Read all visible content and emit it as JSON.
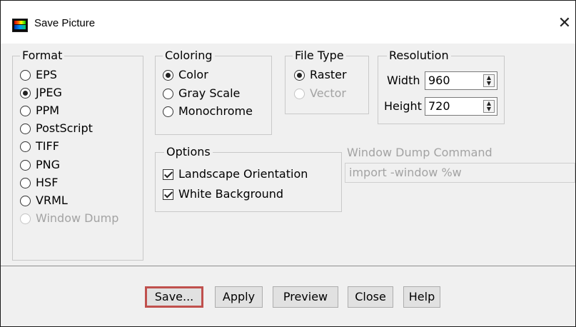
{
  "window": {
    "title": "Save Picture",
    "close_glyph": "✕"
  },
  "format": {
    "legend": "Format",
    "options": [
      {
        "label": "EPS",
        "selected": false,
        "disabled": false
      },
      {
        "label": "JPEG",
        "selected": true,
        "disabled": false
      },
      {
        "label": "PPM",
        "selected": false,
        "disabled": false
      },
      {
        "label": "PostScript",
        "selected": false,
        "disabled": false
      },
      {
        "label": "TIFF",
        "selected": false,
        "disabled": false
      },
      {
        "label": "PNG",
        "selected": false,
        "disabled": false
      },
      {
        "label": "HSF",
        "selected": false,
        "disabled": false
      },
      {
        "label": "VRML",
        "selected": false,
        "disabled": false
      },
      {
        "label": "Window Dump",
        "selected": false,
        "disabled": true
      }
    ]
  },
  "coloring": {
    "legend": "Coloring",
    "options": [
      {
        "label": "Color",
        "selected": true
      },
      {
        "label": "Gray Scale",
        "selected": false
      },
      {
        "label": "Monochrome",
        "selected": false
      }
    ]
  },
  "file_type": {
    "legend": "File Type",
    "options": [
      {
        "label": "Raster",
        "selected": true,
        "disabled": false
      },
      {
        "label": "Vector",
        "selected": false,
        "disabled": true
      }
    ]
  },
  "resolution": {
    "legend": "Resolution",
    "width_label": "Width",
    "width_value": "960",
    "height_label": "Height",
    "height_value": "720"
  },
  "options": {
    "legend": "Options",
    "items": [
      {
        "label": "Landscape Orientation",
        "checked": true
      },
      {
        "label": "White Background",
        "checked": true
      }
    ]
  },
  "window_dump": {
    "label": "Window Dump Command",
    "value": "import -window %w"
  },
  "buttons": {
    "save": "Save...",
    "apply": "Apply",
    "preview": "Preview",
    "close": "Close",
    "help": "Help"
  }
}
